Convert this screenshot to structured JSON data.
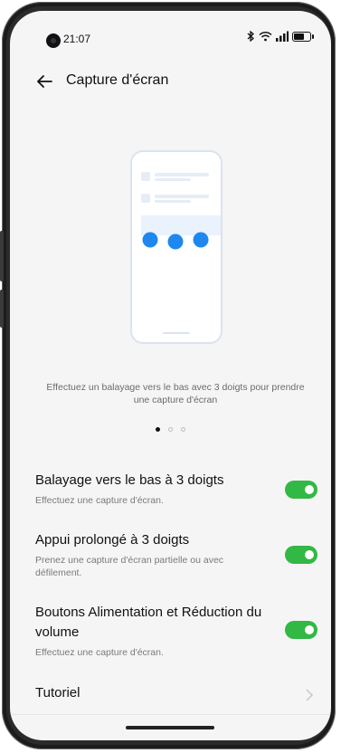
{
  "status_bar": {
    "time": "21:07",
    "icons": [
      "bluetooth-icon",
      "wifi-icon",
      "signal-icon",
      "battery-icon"
    ]
  },
  "header": {
    "title": "Capture d'écran",
    "back_icon": "back-arrow-icon"
  },
  "illustration": {
    "caption": "Effectuez un balayage vers le bas avec 3 doigts pour prendre une capture d'écran",
    "pages": 3,
    "active_page": 1
  },
  "settings": [
    {
      "title": "Balayage vers le bas à 3 doigts",
      "subtitle": "Effectuez une capture d'écran.",
      "enabled": true
    },
    {
      "title": "Appui prolongé à 3 doigts",
      "subtitle": "Prenez une capture d'écran partielle ou avec défilement.",
      "enabled": true
    },
    {
      "title": "Boutons Alimentation et Réduction du volume",
      "subtitle": "Effectuez une capture d'écran.",
      "enabled": true
    }
  ],
  "tutorial": {
    "label": "Tutoriel"
  },
  "colors": {
    "toggle_on": "#32b845",
    "accent_blue": "#1e88f0"
  }
}
